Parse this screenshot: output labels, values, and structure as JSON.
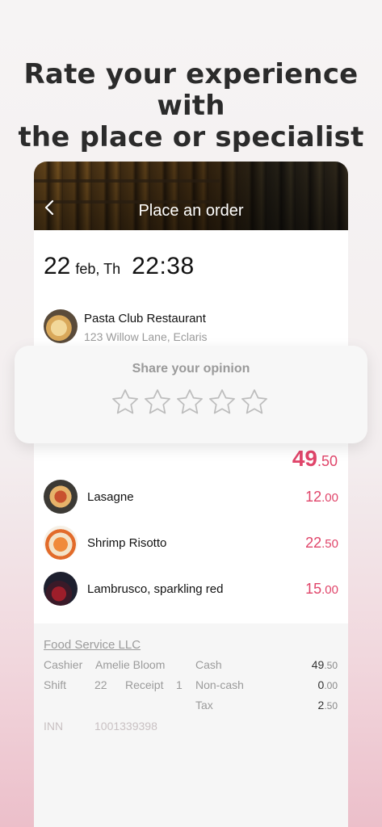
{
  "headline": {
    "line1": "Rate your experience with",
    "line2": "the place or specialist"
  },
  "order": {
    "title": "Place an order",
    "back_icon": "chevron-left-icon",
    "date_day": "22",
    "date_rest": "feb, Th",
    "time": "22:38",
    "venue_name": "Pasta Club Restaurant",
    "venue_address": "123 Willow Lane, Eclaris",
    "total_int": "49",
    "total_dec": ".50",
    "items": [
      {
        "name": "Lasagne",
        "price_int": "12",
        "price_dec": ".00"
      },
      {
        "name": "Shrimp Risotto",
        "price_int": "22",
        "price_dec": ".50"
      },
      {
        "name": "Lambrusco, sparkling red",
        "price_int": "15",
        "price_dec": ".00"
      }
    ]
  },
  "rating": {
    "title": "Share your opinion",
    "max_stars": 5,
    "selected": 0,
    "star_icon": "star-outline-icon"
  },
  "receipt": {
    "company": "Food Service LLC",
    "cashier_label": "Cashier",
    "cashier_value": "Amelie Bloom",
    "shift_label": "Shift",
    "shift_value": "22",
    "receipt_label": "Receipt",
    "receipt_value": "1",
    "cash_label": "Cash",
    "cash_int": "49",
    "cash_dec": ".50",
    "noncash_label": "Non-cash",
    "noncash_int": "0",
    "noncash_dec": ".00",
    "tax_label": "Tax",
    "tax_int": "2",
    "tax_dec": ".50",
    "inn_label": "INN",
    "inn_value": "1001339398"
  },
  "colors": {
    "accent": "#e0456a",
    "text": "#111111",
    "muted": "#9b9b9b"
  }
}
